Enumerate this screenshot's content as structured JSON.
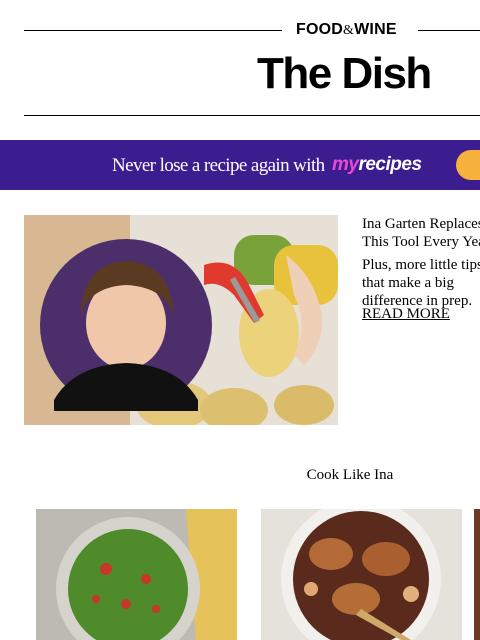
{
  "header": {
    "brand_left": "FOOD",
    "brand_amp": "&",
    "brand_right": "WINE",
    "newsletter_title": "The Dish"
  },
  "banner": {
    "text": "Never lose a recipe again with",
    "logo_my": "my",
    "logo_recipes": "recipes",
    "bg_color": "#3b1d8f",
    "button_color": "#f6b23c"
  },
  "article": {
    "title": "Ina Garten Replaces This Tool Every Year",
    "subtitle": "Plus, more little tips that make a big difference in prep.",
    "read_more": "READ MORE"
  },
  "section": {
    "title": "Cook Like Ina"
  },
  "cards": [
    {
      "name": "guacamole-image"
    },
    {
      "name": "chicken-stew-image"
    },
    {
      "name": "third-recipe-image"
    }
  ]
}
